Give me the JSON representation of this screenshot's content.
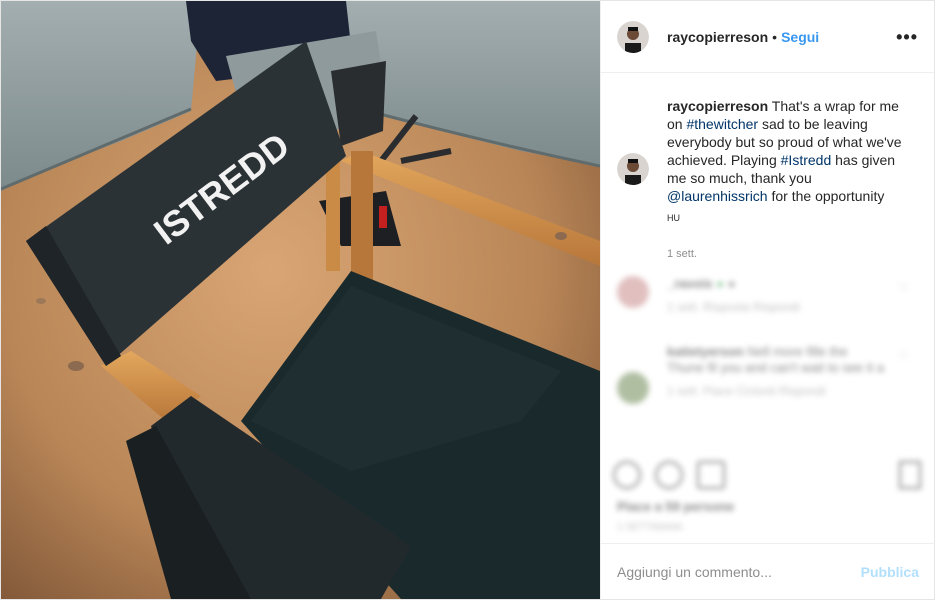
{
  "header": {
    "username": "raycopierreson",
    "separator": "•",
    "follow_label": "Segui",
    "more_icon": "more-horizontal-icon"
  },
  "photo": {
    "chair_back_text": "ISTREDD"
  },
  "caption": {
    "username": "raycopierreson",
    "text_1": " That's a wrap for me on ",
    "tag_1": "#thewitcher",
    "text_2": " sad to be leaving everybody but so proud of what we've achieved. Playing ",
    "tag_2": "#Istredd",
    "text_3": " has given me so much, thank you ",
    "tag_3": "@laurenhissrich",
    "text_4": " for the opportunity",
    "translation_label": "HU",
    "time": "1 sett."
  },
  "blurred": {
    "comment_1": {
      "user": "_ravois",
      "text": "",
      "meta": "1 sett.   Risposta   Rispondi"
    },
    "comment_2": {
      "user": "katietyerson",
      "text": "Nell more fille the Thune fil you and can't wait to see it a",
      "meta": "1 sett.   Piace Ciclonti   Rispondi"
    },
    "likes": "Piace a 59 persone",
    "date": "1 SETTIMANA"
  },
  "add_comment": {
    "placeholder": "Aggiungi un commento...",
    "publish_label": "Pubblica"
  },
  "colors": {
    "accent": "#3897f0",
    "link": "#003569",
    "publish_disabled": "#b2dffc"
  }
}
